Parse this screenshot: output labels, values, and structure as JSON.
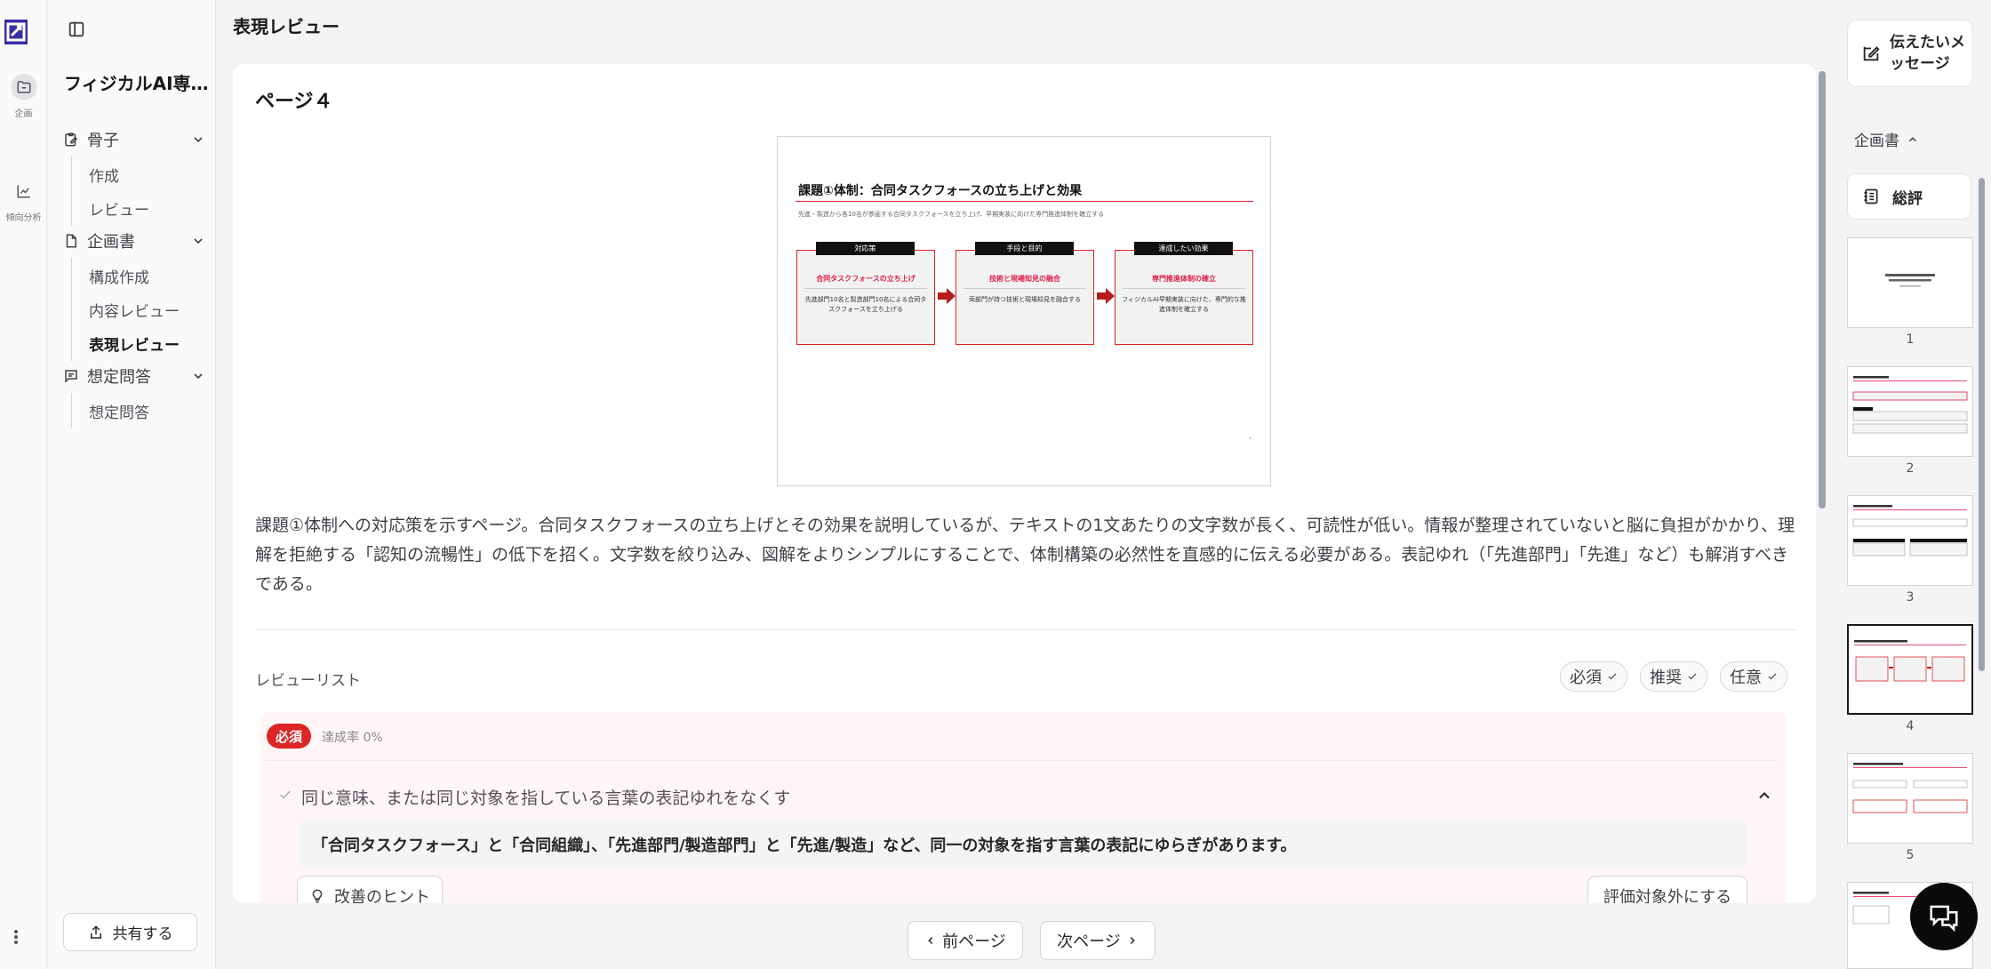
{
  "rail": {
    "items": [
      {
        "label": "企画",
        "icon": "folder-icon"
      },
      {
        "label": "傾向分析",
        "icon": "line-chart-icon"
      }
    ]
  },
  "nav": {
    "project_title": "フィジカルAI専...",
    "sections": [
      {
        "label": "骨子",
        "icon": "clipboard-edit-icon",
        "items": [
          "作成",
          "レビュー"
        ]
      },
      {
        "label": "企画書",
        "icon": "document-icon",
        "items": [
          "構成作成",
          "内容レビュー",
          "表現レビュー"
        ]
      },
      {
        "label": "想定問答",
        "icon": "message-square-icon",
        "items": [
          "想定問答"
        ]
      }
    ],
    "active_item": "表現レビュー",
    "share_label": "共有する"
  },
  "main": {
    "heading": "表現レビュー",
    "page_title": "ページ４",
    "slide": {
      "title": "課題①体制：合同タスクフォースの立ち上げと効果",
      "subtitle": "先進・製造から各10名が参画する合同タスクフォースを立ち上げ、早期実装に向けた専門推進体制を確立する",
      "columns": [
        {
          "tag": "対応策",
          "heading": "合同タスクフォースの立ち上げ",
          "text": "先進部門10名と製造部門10名による合同タスクフォースを立ち上げる"
        },
        {
          "tag": "手段と目的",
          "heading": "技術と現場知見の融合",
          "text": "両部門が持つ技術と現場知見を融合する"
        },
        {
          "tag": "達成したい効果",
          "heading": "専門推進体制の確立",
          "text": "フィジカルAI早期実装に向けた、専門的な推進体制を確立する"
        }
      ]
    },
    "description": "課題①体制への対応策を示すページ。合同タスクフォースの立ち上げとその効果を説明しているが、テキストの1文あたりの文字数が長く、可読性が低い。情報が整理されていないと脳に負担がかかり、理解を拒絶する「認知の流暢性」の低下を招く。文字数を絞り込み、図解をよりシンプルにすることで、体制構築の必然性を直感的に伝える必要がある。表記ゆれ（「先進部門」「先進」など）も解消すべきである。",
    "review_list_label": "レビューリスト",
    "filters": [
      "必須",
      "推奨",
      "任意"
    ],
    "group": {
      "badge": "必須",
      "rate": "達成率 0%",
      "item_title": "同じ意味、または同じ対象を指している言葉の表記ゆれをなくす",
      "item_detail": "「合同タスクフォース」と「合同組織」、「先進部門/製造部門」と「先進/製造」など、同一の対象を指す言葉の表記にゆらぎがあります。",
      "hint_label": "改善のヒント",
      "exclude_label": "評価対象外にする"
    },
    "prev_label": "前ページ",
    "next_label": "次ページ"
  },
  "right_panel": {
    "message_label": "伝えたいメッセージ",
    "doc_label": "企画書",
    "review_label": "総評",
    "thumbnails": [
      "1",
      "2",
      "3",
      "4",
      "5"
    ],
    "active_thumbnail": "4"
  },
  "colors": {
    "accent_red": "#dc2626",
    "brand_navy": "#312e81",
    "background": "#f4f4f5"
  }
}
